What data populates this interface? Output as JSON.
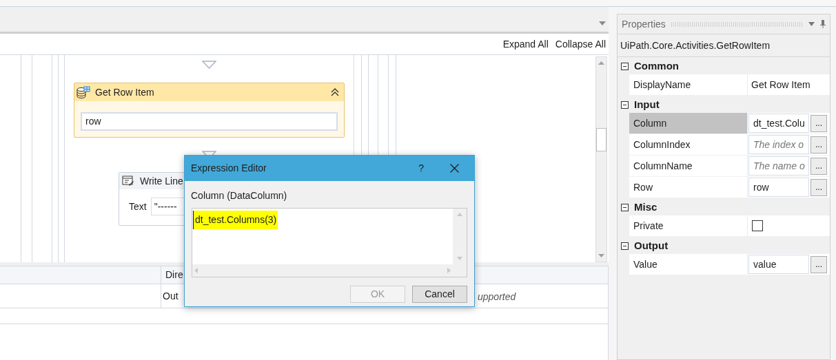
{
  "designer": {
    "expand_all": "Expand All",
    "collapse_all": "Collapse All",
    "get_row_item": {
      "title": "Get Row Item",
      "value": "row"
    },
    "write_line": {
      "title": "Write Line",
      "label": "Text",
      "value": "\"------"
    }
  },
  "arguments": {
    "header": "Dire",
    "cells": [
      {
        "text": "Out",
        "italic": false
      },
      {
        "text": "upported",
        "italic": true
      }
    ]
  },
  "dialog": {
    "title": "Expression Editor",
    "help": "?",
    "label": "Column (DataColumn)",
    "expression": "dt_test.Columns(3)",
    "highlighted": true,
    "buttons": [
      {
        "label": "OK",
        "disabled": true
      },
      {
        "label": "Cancel",
        "disabled": false
      }
    ]
  },
  "properties": {
    "title": "Properties",
    "type_name": "UiPath.Core.Activities.GetRowItem",
    "categories": [
      {
        "name": "Common",
        "expanded": true,
        "rows": [
          {
            "name": "DisplayName",
            "kind": "text",
            "value": "Get Row Item",
            "selected": false
          }
        ]
      },
      {
        "name": "Input",
        "expanded": true,
        "rows": [
          {
            "name": "Column",
            "kind": "field",
            "value": "dt_test.Colu",
            "button": "...",
            "selected": true
          },
          {
            "name": "ColumnIndex",
            "kind": "field",
            "placeholder": "The index o",
            "button": "...",
            "selected": false
          },
          {
            "name": "ColumnName",
            "kind": "field",
            "placeholder": "The name o",
            "button": "...",
            "selected": false
          },
          {
            "name": "Row",
            "kind": "field",
            "value": "row",
            "button": "...",
            "selected": false
          }
        ]
      },
      {
        "name": "Misc",
        "expanded": true,
        "rows": [
          {
            "name": "Private",
            "kind": "checkbox",
            "checked": false,
            "selected": false
          }
        ]
      },
      {
        "name": "Output",
        "expanded": true,
        "rows": [
          {
            "name": "Value",
            "kind": "field",
            "value": "value",
            "button": "...",
            "selected": false
          }
        ]
      }
    ]
  }
}
